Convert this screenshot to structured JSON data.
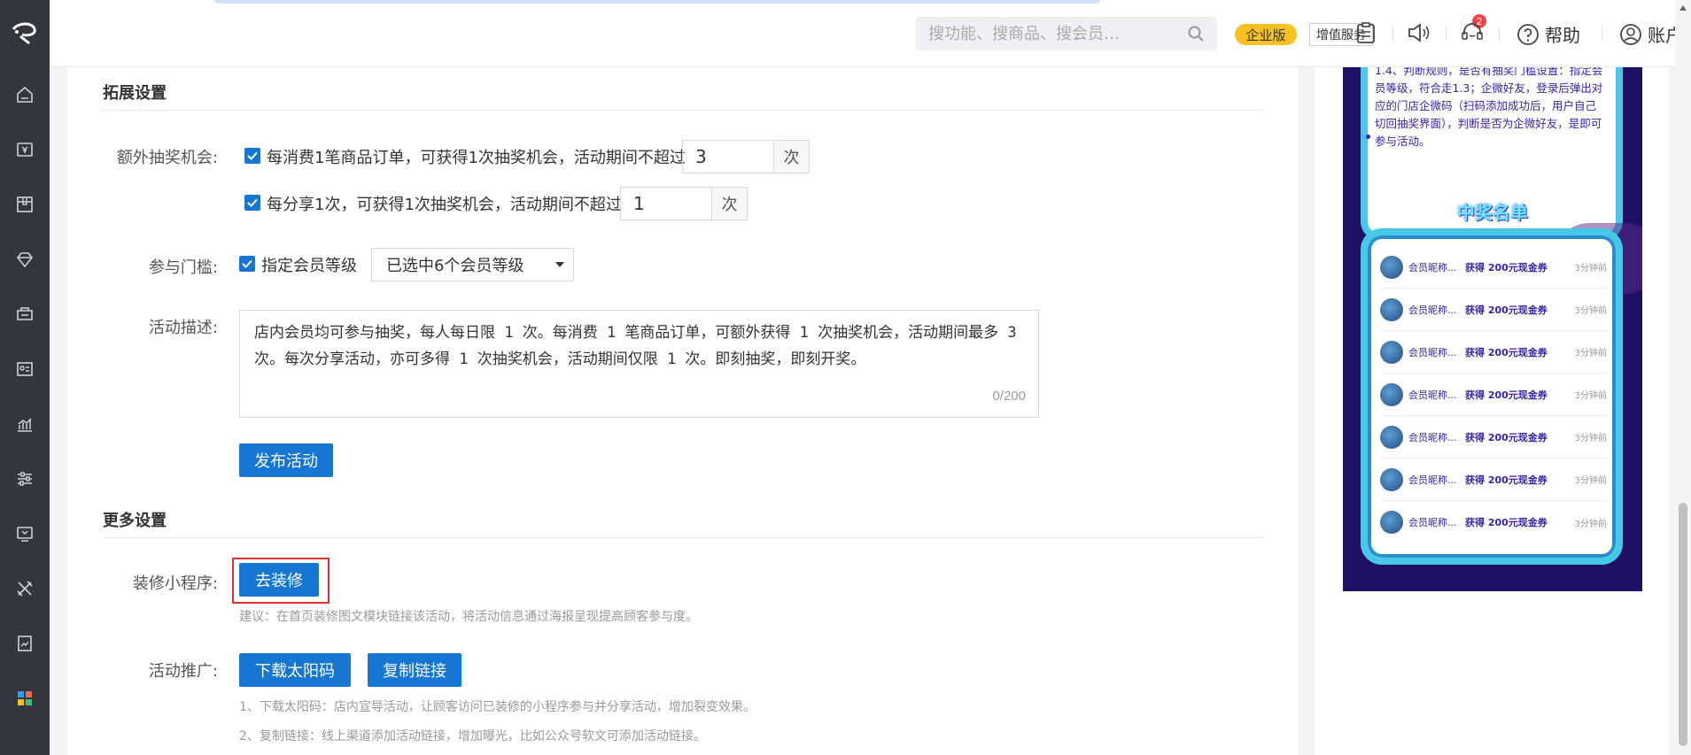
{
  "topbar": {
    "search_placeholder": "搜功能、搜商品、搜会员…",
    "edition_badge": "企业版",
    "value_added_label": "增值服务",
    "notification_count": "2",
    "help_label": "帮助",
    "account_label": "账户"
  },
  "sidebar": {
    "items": [
      "home-icon",
      "cashier-icon",
      "goods-icon",
      "member-icon",
      "marketing-icon",
      "staff-icon",
      "report-icon",
      "settings-icon",
      "device-icon",
      "tools-icon",
      "finance-icon",
      "apps-icon"
    ]
  },
  "expand_settings": {
    "title": "拓展设置",
    "extra_chance_label": "额外抽奖机会:",
    "order_option_text": "每消费1笔商品订单，可获得1次抽奖机会，活动期间不超过",
    "order_option_value": "3",
    "order_option_unit": "次",
    "share_option_text": "每分享1次，可获得1次抽奖机会，活动期间不超过",
    "share_option_value": "1",
    "share_option_unit": "次",
    "threshold_label": "参与门槛:",
    "threshold_option_text": "指定会员等级",
    "threshold_select_value": "已选中6个会员等级",
    "description_label": "活动描述:",
    "description_text": "店内会员均可参与抽奖，每人每日限 1 次。每消费 1 笔商品订单，可额外获得 1 次抽奖机会，活动期间最多 3 次。每次分享活动，亦可多得 1 次抽奖机会，活动期间仅限 1 次。即刻抽奖，即刻开奖。",
    "description_counter": "0/200",
    "publish_button": "发布活动"
  },
  "more_settings": {
    "title": "更多设置",
    "decorate_label": "装修小程序:",
    "decorate_button": "去装修",
    "decorate_hint": "建议：在首页装修图文模块链接该活动，将活动信息通过海报呈现提高顾客参与度。",
    "promo_label": "活动推广:",
    "download_button": "下载太阳码",
    "copy_button": "复制链接",
    "promo_hint_1": "1、下载太阳码：店内宣导活动，让顾客访问已装修的小程序参与并分享活动，增加裂变效果。",
    "promo_hint_2": "2、复制链接：线上渠道添加活动链接，增加曝光，比如公众号软文可添加活动链接。"
  },
  "preview": {
    "rules_text": "1.4、判断规则，是否有抽奖门槛设置：指定会员等级，符合走1.3；企微好友，登录后弹出对应的门店企微码（扫码添加成功后，用户自己切回抽奖界面），判断是否为企微好友，是即可参与活动。",
    "winners_title": "中奖名单",
    "winners": [
      {
        "name": "会员昵称...",
        "prize": "获得 200元现金券",
        "time": "3分钟前"
      },
      {
        "name": "会员昵称...",
        "prize": "获得 200元现金券",
        "time": "3分钟前"
      },
      {
        "name": "会员昵称...",
        "prize": "获得 200元现金券",
        "time": "3分钟前"
      },
      {
        "name": "会员昵称...",
        "prize": "获得 200元现金券",
        "time": "3分钟前"
      },
      {
        "name": "会员昵称...",
        "prize": "获得 200元现金券",
        "time": "3分钟前"
      },
      {
        "name": "会员昵称...",
        "prize": "获得 200元现金券",
        "time": "3分钟前"
      },
      {
        "name": "会员昵称...",
        "prize": "获得 200元现金券",
        "time": "3分钟前"
      }
    ]
  },
  "colors": {
    "primary": "#1677d2",
    "sidebar_bg": "#33373d",
    "edition_badge_bg": "#f7c221",
    "preview_bg": "#1f1065",
    "highlight_border": "#e53030"
  }
}
